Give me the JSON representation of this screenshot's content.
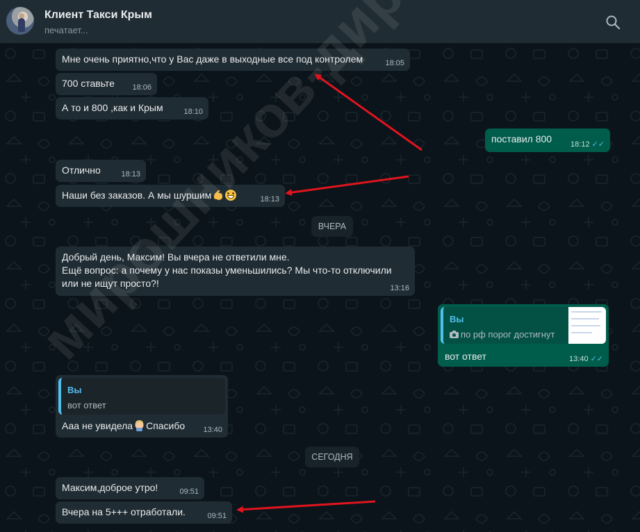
{
  "header": {
    "contact_name": "Клиент Такси Крым",
    "status": "печатает..."
  },
  "messages": {
    "m0": {
      "text": "Мне очень приятно,что у Вас даже в выходные все под контролем",
      "time": "18:05"
    },
    "m1": {
      "text": "700 ставьте",
      "time": "18:06"
    },
    "m2": {
      "text": "А то и 800 ,как и Крым",
      "time": "18:10"
    },
    "m3": {
      "text": "поставил 800",
      "time": "18:12"
    },
    "m4": {
      "text": "Отлично",
      "time": "18:13"
    },
    "m5": {
      "text": "Наши без заказов. А мы шуршим",
      "time": "18:13"
    },
    "m6": {
      "lines": [
        "Добрый день, Максим! Вы вчера не ответили мне.",
        "Ещё вопрос: а почему у нас показы уменьшились? Мы что-то отключили",
        "или не ищут просто?!"
      ],
      "time": "13:16"
    },
    "m7": {
      "quote_author": "Вы",
      "quote_text": "по рф порог достигнут",
      "text": "вот ответ",
      "time": "13:40"
    },
    "m8": {
      "quote_author": "Вы",
      "quote_text": "вот ответ",
      "text_before": "Ааа не увидела",
      "text_after": "Спасибо",
      "time": "13:40"
    },
    "m9": {
      "text": "Максим,доброе утро!",
      "time": "09:51"
    },
    "m10": {
      "text": "Вчера на 5+++ отработали.",
      "time": "09:51"
    }
  },
  "dates": {
    "yesterday": "ВЧЕРА",
    "today": "СЕГОДНЯ"
  },
  "watermark": "мирошников-директ.рф",
  "colors": {
    "header_bg": "#202c33",
    "chat_bg": "#0b141a",
    "incoming_bubble": "#202c33",
    "outgoing_bubble": "#005c4b",
    "read_ticks": "#53bdeb",
    "annotation_arrow": "#e0141e"
  },
  "icons": {
    "search": "search-icon",
    "read_receipt": "double-check-icon",
    "photo": "camera-icon"
  }
}
